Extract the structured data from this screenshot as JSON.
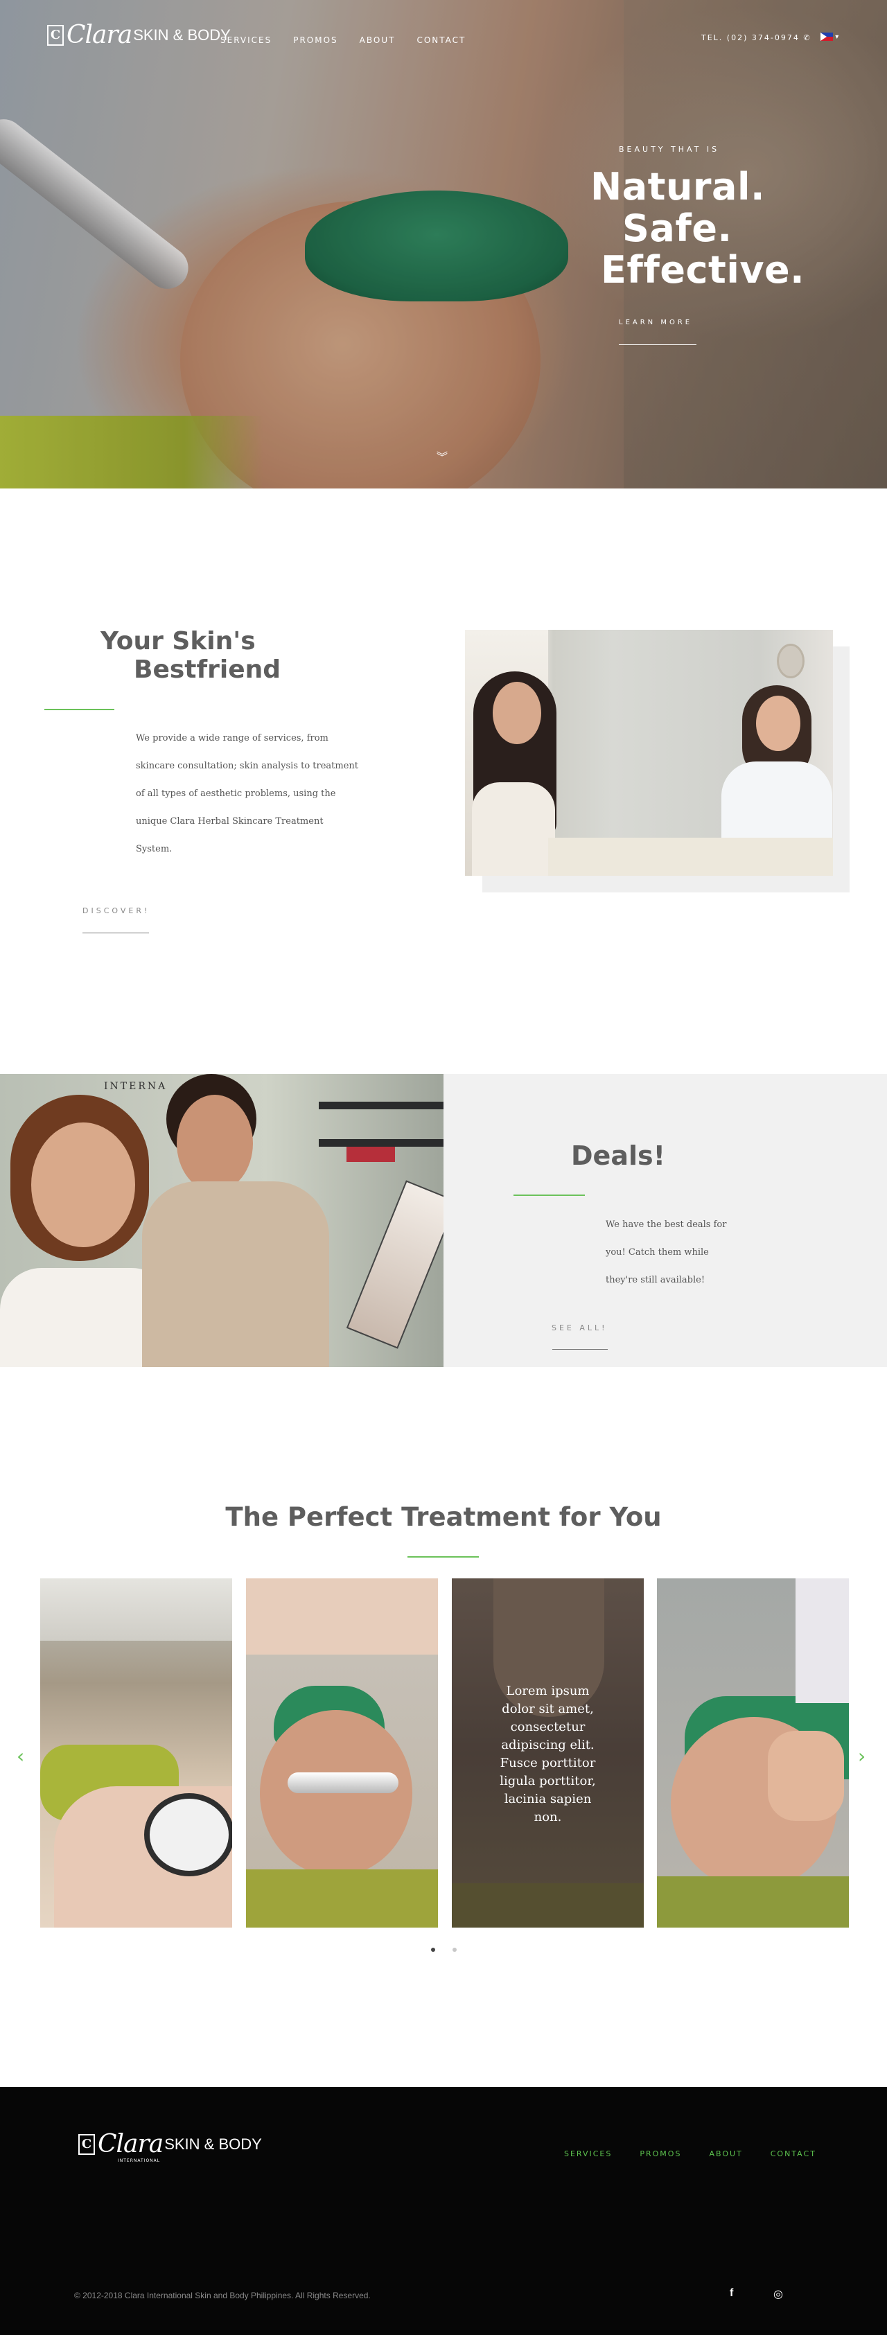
{
  "header": {
    "logo": {
      "mark": "C",
      "script": "Clara",
      "sub": "SKIN & BODY"
    },
    "nav": [
      "SERVICES",
      "PROMOS",
      "ABOUT",
      "CONTACT"
    ],
    "tel": "TEL. (02) 374-0974 ✆",
    "language_caret": "▾"
  },
  "hero": {
    "kicker": "BEAUTY THAT IS",
    "line1": "Natural.",
    "line2": "Safe.",
    "line3": "Effective.",
    "cta": "LEARN MORE",
    "scroll_icon": "︾"
  },
  "skin": {
    "title_line1": "Your Skin's",
    "title_line2": "Bestfriend",
    "body": [
      "We provide a wide range of services, from",
      "skincare consultation; skin analysis to treatment",
      "of all types of aesthetic problems, using the",
      "unique Clara Herbal Skincare Treatment",
      "System."
    ],
    "cta": "DISCOVER!"
  },
  "deals": {
    "title": "Deals!",
    "body": [
      "We have the best deals for",
      "you! Catch them while",
      "they're still available!"
    ],
    "cta": "SEE ALL!",
    "sign_text": "INTERNA"
  },
  "treatments": {
    "title": "The Perfect Treatment for You",
    "overlay_text": "Lorem ipsum dolor sit amet, consectetur adipiscing elit. Fusce porttitor ligula porttitor, lacinia sapien non.",
    "prev_icon": "‹",
    "next_icon": "›"
  },
  "footer": {
    "logo": {
      "mark": "C",
      "script": "Clara",
      "sub": "SKIN & BODY",
      "tiny": "INTERNATIONAL"
    },
    "nav": [
      "SERVICES",
      "PROMOS",
      "ABOUT",
      "CONTACT"
    ],
    "copyright": "© 2012-2018 Clara International Skin and Body Philippines. All Rights Reserved.",
    "social": {
      "facebook": "f",
      "instagram": "◎"
    }
  },
  "colors": {
    "accent": "#6bc25a",
    "footer_bg": "#060606",
    "heading": "#5e5e5e"
  }
}
